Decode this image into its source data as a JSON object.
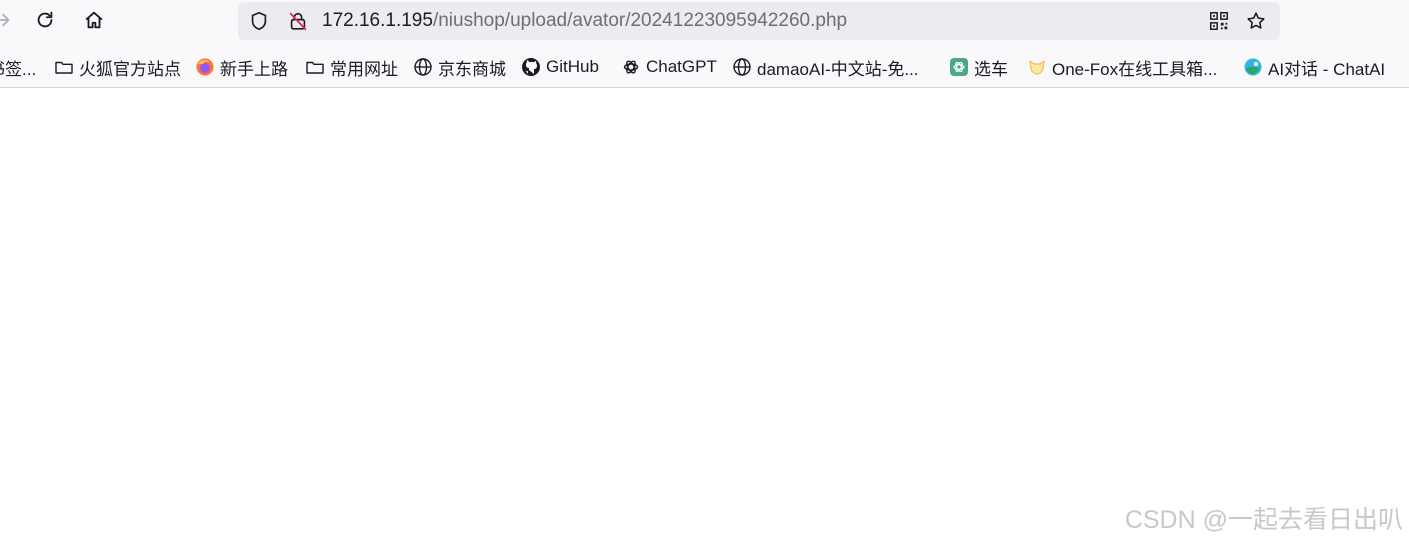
{
  "browser": {
    "url_host": "172.16.1.195",
    "url_path": "/niushop/upload/avator/20241223095942260.php"
  },
  "bookmarks": [
    {
      "label": "书签...",
      "icon": "none"
    },
    {
      "label": "火狐官方站点",
      "icon": "folder-icon"
    },
    {
      "label": "新手上路",
      "icon": "firefox-icon"
    },
    {
      "label": "常用网址",
      "icon": "folder-icon"
    },
    {
      "label": "京东商城",
      "icon": "globe-icon"
    },
    {
      "label": "GitHub",
      "icon": "github-icon"
    },
    {
      "label": "ChatGPT",
      "icon": "openai-icon"
    },
    {
      "label": "damaoAI-中文站-免...",
      "icon": "globe-icon"
    },
    {
      "label": "选车",
      "icon": "chatgpt-green-icon"
    },
    {
      "label": "One-Fox在线工具箱...",
      "icon": "fox-icon"
    },
    {
      "label": "AI对话 - ChatAI",
      "icon": "ai-chat-icon"
    }
  ],
  "watermark": "CSDN @一起去看日出叭"
}
